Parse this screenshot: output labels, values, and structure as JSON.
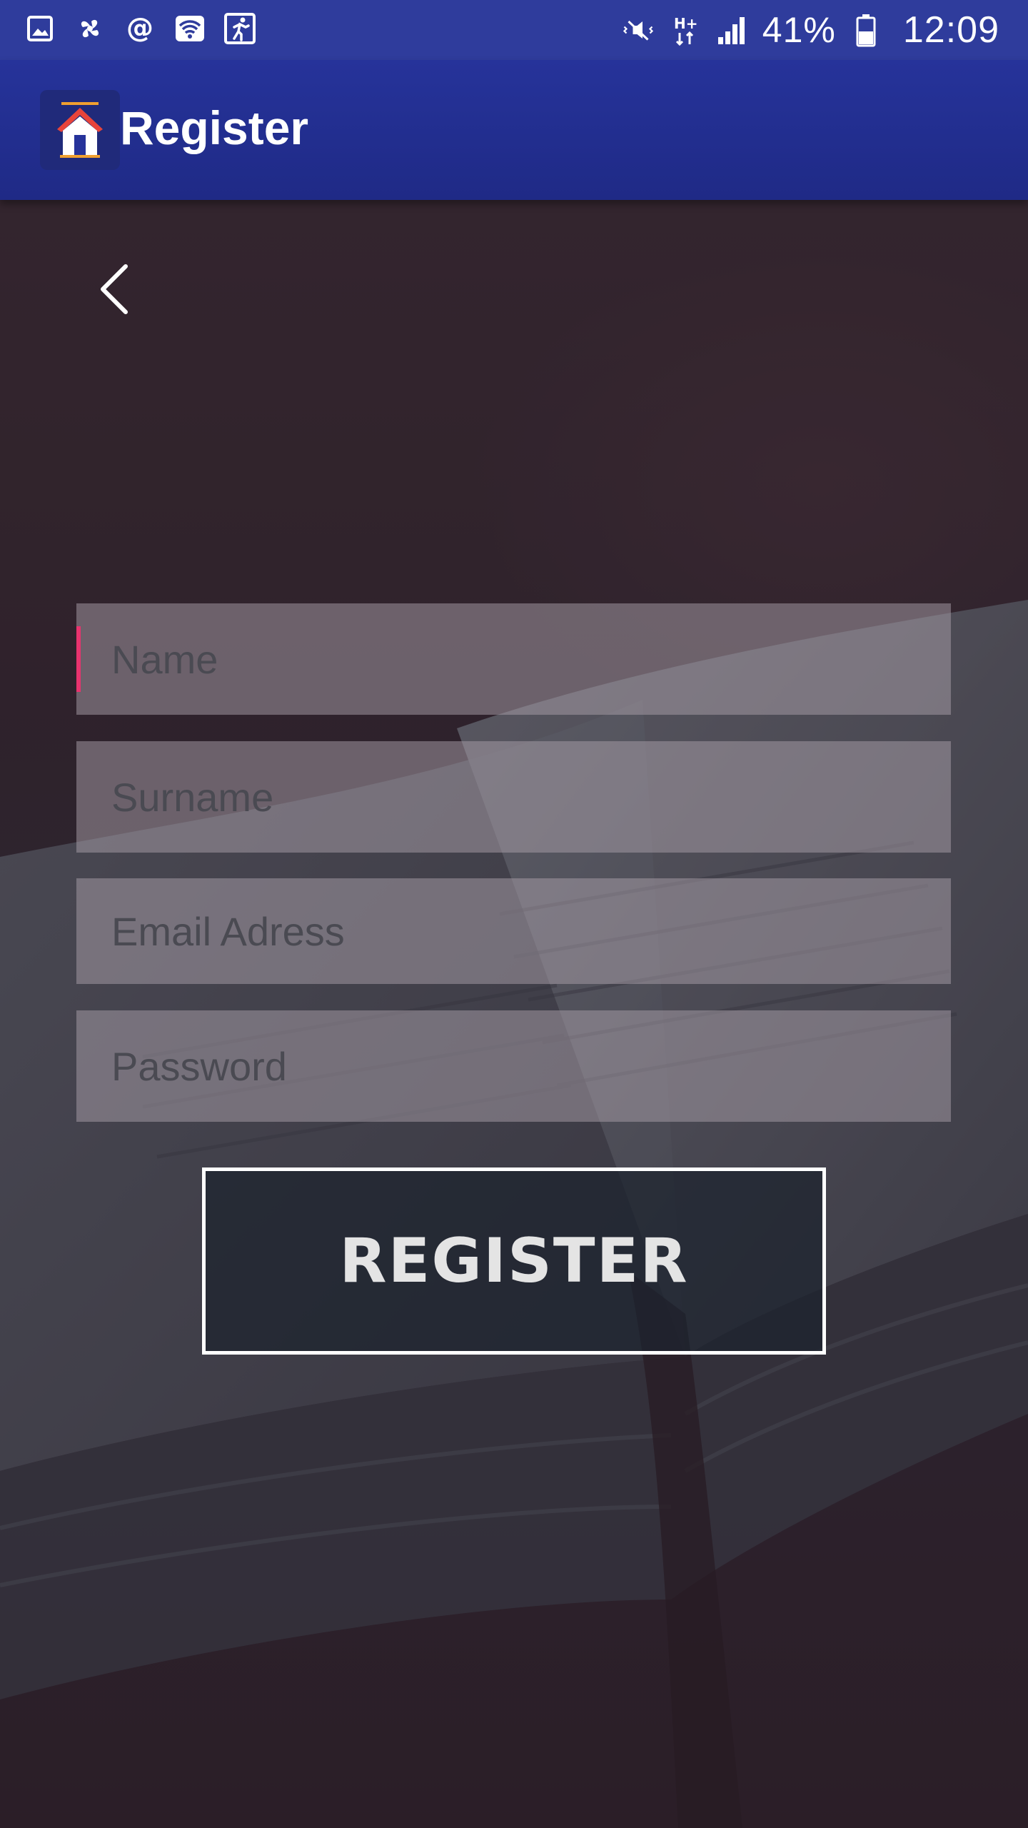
{
  "status_bar": {
    "battery_percent": "41%",
    "time": "12:09",
    "network_type": "H+",
    "left_icons": [
      "gallery-icon",
      "fan-icon",
      "at-sign-icon",
      "wifi-icon",
      "running-icon"
    ],
    "right_icons": [
      "mute-vibrate-icon",
      "data-arrows-icon",
      "signal-icon",
      "battery-icon"
    ]
  },
  "app_bar": {
    "title": "Register",
    "logo_icon": "house-logo-icon"
  },
  "form": {
    "name": {
      "placeholder": "Name",
      "value": ""
    },
    "surname": {
      "placeholder": "Surname",
      "value": ""
    },
    "email": {
      "placeholder": "Email Adress",
      "value": ""
    },
    "password": {
      "placeholder": "Password",
      "value": ""
    },
    "register_label": "REGISTER"
  },
  "colors": {
    "status_bar": "#2f3c9c",
    "app_bar": "#26339a",
    "caret": "#e8336e",
    "field_bg": "rgba(170,160,170,0.5)",
    "button_border": "#ffffff"
  }
}
